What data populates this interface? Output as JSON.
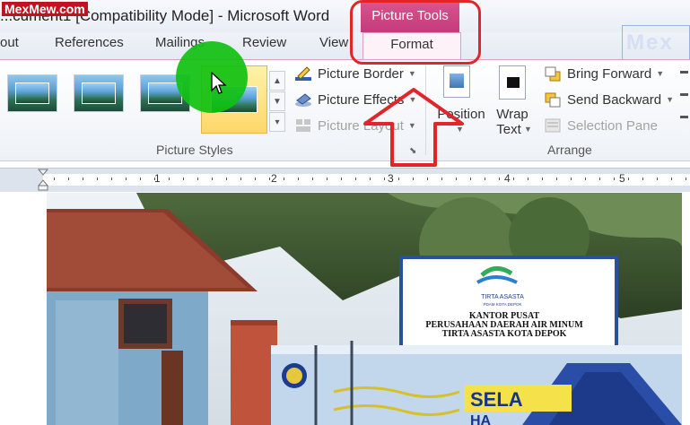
{
  "watermark": "MexMew.com",
  "watermark_right": "Mex",
  "title": "...cument1 [Compatibility Mode]  -  Microsoft Word",
  "context_tab": {
    "group_title": "Picture Tools",
    "tab_label": "Format"
  },
  "tabs": [
    {
      "label": "out"
    },
    {
      "label": "References"
    },
    {
      "label": "Mailings"
    },
    {
      "label": "Review"
    },
    {
      "label": "View"
    }
  ],
  "picture_styles": {
    "label": "Picture Styles",
    "commands": [
      {
        "label": "Picture Border",
        "icon": "pencil-border-icon",
        "enabled": true
      },
      {
        "label": "Picture Effects",
        "icon": "effects-icon",
        "enabled": true
      },
      {
        "label": "Picture Layout",
        "icon": "layout-icon",
        "enabled": false
      }
    ]
  },
  "arrange": {
    "label": "Arrange",
    "position_label": "Position",
    "wrap_text_label_1": "Wrap",
    "wrap_text_label_2": "Text",
    "commands": [
      {
        "label": "Bring Forward",
        "icon": "bring-forward-icon",
        "enabled": true
      },
      {
        "label": "Send Backward",
        "icon": "send-backward-icon",
        "enabled": true
      },
      {
        "label": "Selection Pane",
        "icon": "selection-pane-icon",
        "enabled": false
      }
    ]
  },
  "ruler": {
    "numbers": [
      "1",
      "2",
      "3",
      "4",
      "5"
    ]
  },
  "photo": {
    "sign_company": "TIRTA ASASTA",
    "sign_sub": "PDAM KOTA DEPOK",
    "sign_line1": "KANTOR PUSAT",
    "sign_line2": "PERUSAHAAN DAERAH AIR MINUM",
    "sign_line3": "TIRTA ASASTA KOTA DEPOK",
    "banner_text": "SELA",
    "banner_text2": "HA"
  },
  "colors": {
    "accent": "#c43b7b",
    "highlight": "#e0252b",
    "green_marker": "#10c010"
  }
}
